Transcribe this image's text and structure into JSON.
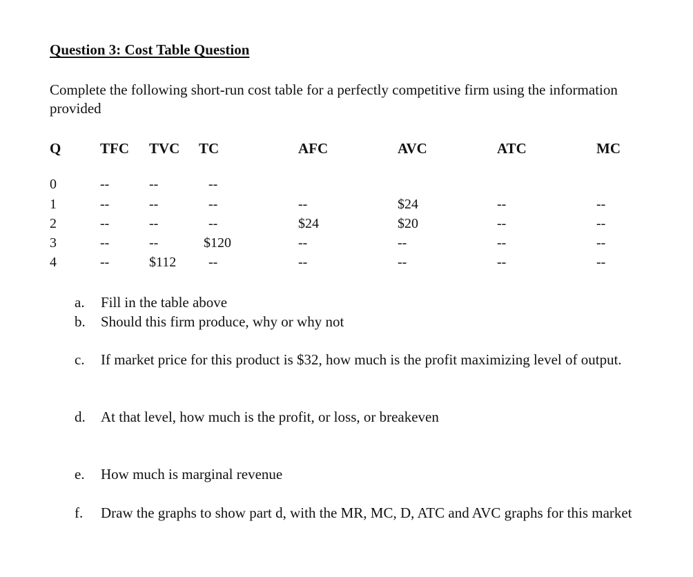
{
  "document": {
    "title": "Question 3: Cost Table Question",
    "intro": "Complete the following short-run cost table for a perfectly competitive firm using the information provided"
  },
  "table": {
    "headers": [
      "Q",
      "TFC",
      "TVC",
      "TC",
      "AFC",
      "AVC",
      "ATC",
      "MC"
    ],
    "rows": [
      [
        "0",
        "--",
        "--",
        "--",
        "",
        "",
        "",
        ""
      ],
      [
        "1",
        "--",
        "--",
        "--",
        "--",
        "$24",
        "--",
        "--"
      ],
      [
        "2",
        "--",
        "--",
        "--",
        "$24",
        "$20",
        "--",
        "--"
      ],
      [
        "3",
        "--",
        "--",
        "$120",
        "--",
        "--",
        "--",
        "--"
      ],
      [
        "4",
        "--",
        "$112",
        "--",
        "--",
        "--",
        "--",
        "--"
      ]
    ]
  },
  "questions": [
    {
      "letter": "a.",
      "text": "Fill in the table above"
    },
    {
      "letter": "b.",
      "text": "Should this firm produce, why or why not"
    },
    {
      "letter": "c.",
      "text": "If market price for this product is $32, how much is the profit maximizing level of output."
    },
    {
      "letter": "d.",
      "text": "At that level, how much is the profit, or loss, or breakeven"
    },
    {
      "letter": "e.",
      "text": "How much is marginal revenue"
    },
    {
      "letter": "f.",
      "text": "Draw the graphs to show part d, with the MR, MC, D, ATC and AVC graphs for this market"
    }
  ]
}
